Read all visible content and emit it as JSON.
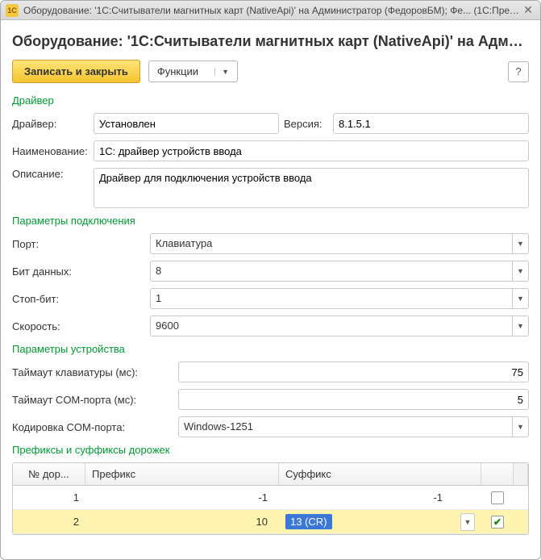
{
  "titlebar": {
    "icon_text": "1C",
    "text": "Оборудование: '1С:Считыватели магнитных карт (NativeApi)' на Администратор (ФедоровБМ); Фе... (1С:Предприятие)"
  },
  "page_title": "Оборудование: '1С:Считыватели магнитных карт (NativeApi)' на Админ...",
  "toolbar": {
    "save_close": "Записать и закрыть",
    "functions": "Функции",
    "help": "?"
  },
  "sections": {
    "driver": "Драйвер",
    "connection": "Параметры подключения",
    "device": "Параметры устройства",
    "tracks": "Префиксы и суффиксы дорожек"
  },
  "driver": {
    "driver_label": "Драйвер:",
    "driver_value": "Установлен",
    "version_label": "Версия:",
    "version_value": "8.1.5.1",
    "name_label": "Наименование:",
    "name_value": "1С: драйвер устройств ввода",
    "desc_label": "Описание:",
    "desc_value": "Драйвер для подключения устройств ввода"
  },
  "connection": {
    "port_label": "Порт:",
    "port_value": "Клавиатура",
    "databits_label": "Бит данных:",
    "databits_value": "8",
    "stopbit_label": "Стоп-бит:",
    "stopbit_value": "1",
    "speed_label": "Скорость:",
    "speed_value": "9600"
  },
  "device": {
    "kb_timeout_label": "Таймаут клавиатуры (мс):",
    "kb_timeout_value": "75",
    "com_timeout_label": "Таймаут COM-порта (мс):",
    "com_timeout_value": "5",
    "com_encoding_label": "Кодировка COM-порта:",
    "com_encoding_value": "Windows-1251"
  },
  "tracks": {
    "columns": {
      "num": "№ дор...",
      "prefix": "Префикс",
      "suffix": "Суффикс"
    },
    "rows": [
      {
        "num": "1",
        "prefix": "-1",
        "suffix": "-1",
        "checked": false
      },
      {
        "num": "2",
        "prefix": "10",
        "suffix": "13 (CR)",
        "checked": true
      }
    ]
  }
}
